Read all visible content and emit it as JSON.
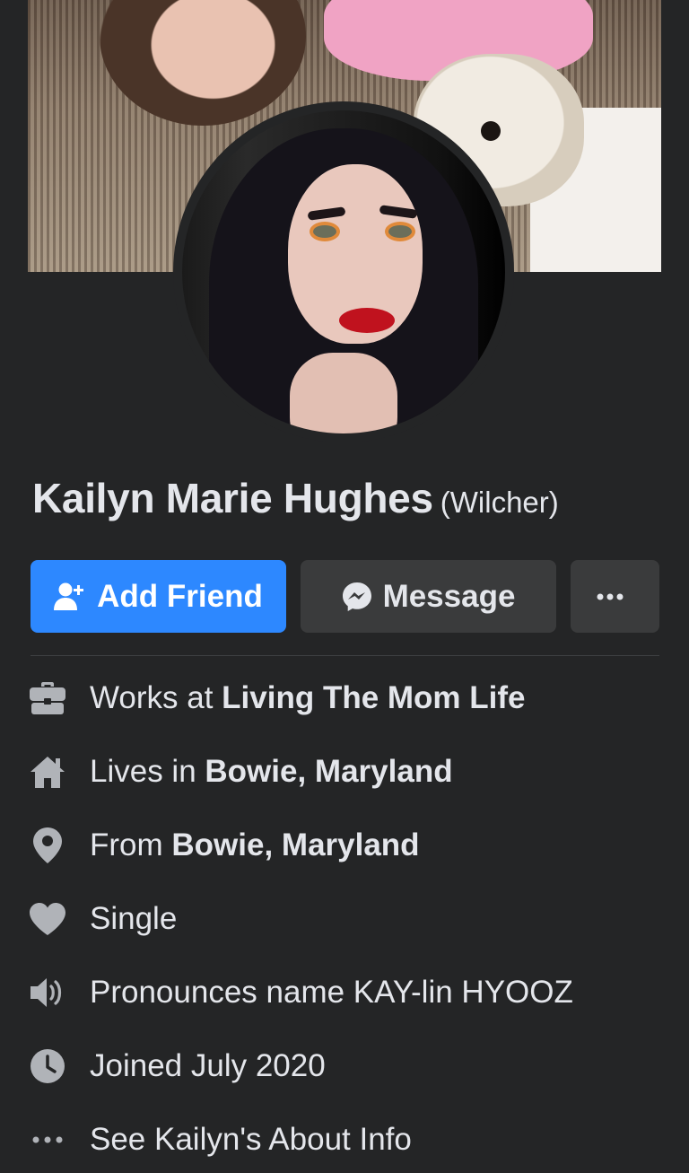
{
  "profile": {
    "name": "Kailyn Marie Hughes",
    "alternate_name": "(Wilcher)"
  },
  "actions": {
    "add_friend": "Add Friend",
    "message": "Message",
    "more": "···"
  },
  "info": {
    "work_prefix": "Works at ",
    "work_value": "Living The Mom Life",
    "lives_prefix": "Lives in ",
    "lives_value": "Bowie, Maryland",
    "from_prefix": "From ",
    "from_value": "Bowie, Maryland",
    "relationship": "Single",
    "pronunciation": "Pronounces name KAY-lin HYOOZ",
    "joined": "Joined July 2020",
    "see_about": "See Kailyn's About Info"
  },
  "colors": {
    "background": "#242526",
    "primary": "#2d88ff",
    "secondary_button": "#3a3b3c",
    "icon": "#b0b3b8",
    "text": "#e4e6eb"
  },
  "icons": {
    "add_friend": "person-plus-icon",
    "message": "messenger-icon",
    "work": "briefcase-icon",
    "lives": "home-icon",
    "from": "location-pin-icon",
    "relationship": "heart-icon",
    "pronunciation": "speaker-icon",
    "joined": "clock-icon",
    "see_about": "ellipsis-icon"
  }
}
